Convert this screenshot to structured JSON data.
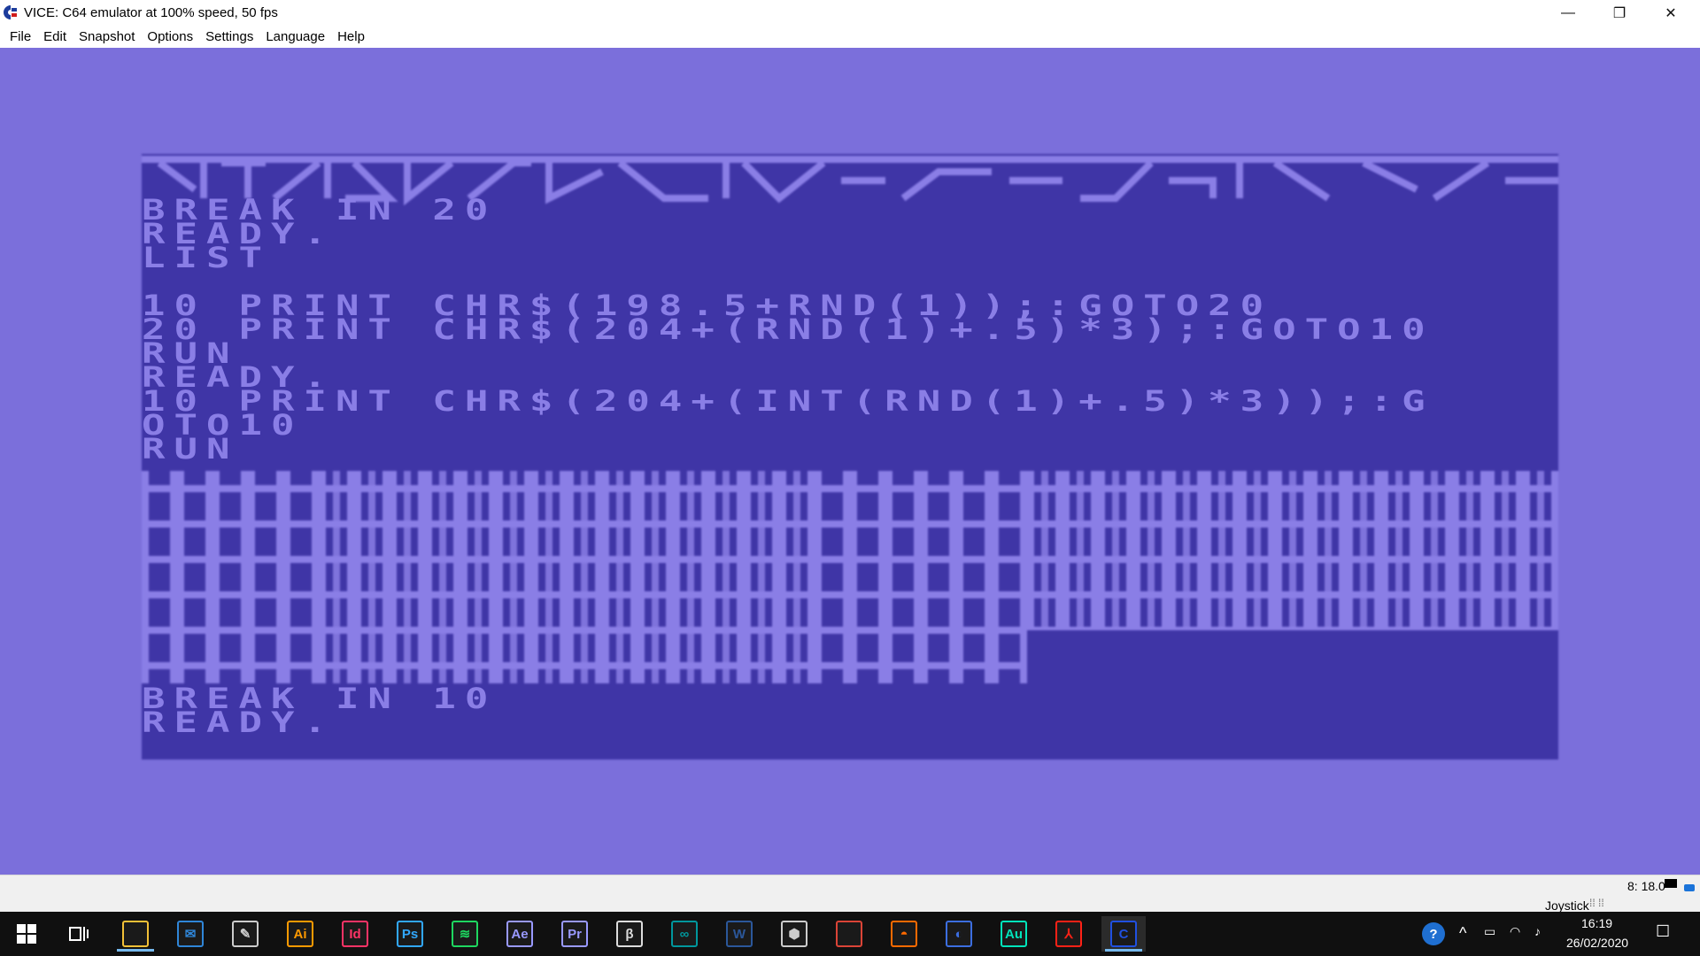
{
  "window": {
    "title": "VICE: C64 emulator at 100% speed, 50 fps",
    "minimize_glyph": "—",
    "restore_glyph": "❐",
    "close_glyph": "✕"
  },
  "menu": [
    "File",
    "Edit",
    "Snapshot",
    "Options",
    "Settings",
    "Language",
    "Help"
  ],
  "screen": {
    "lines": [
      "BREAK IN 20",
      "READY.",
      "LIST",
      "",
      "10 PRINT CHR$(198.5+RND(1));:GOTO20",
      "20 PRINT CHR$(204+(RND(1)+.5)*3);:GOTO10",
      "RUN",
      "READY.",
      "10 PRINT CHR$(204+(INT(RND(1)+.5)*3));:G",
      "OTO10",
      "RUN"
    ],
    "bottom_lines": [
      "BREAK IN 10",
      "READY."
    ],
    "colors": {
      "border": "#7b6fdb",
      "background": "#3f35a6",
      "text": "#8a7ee6"
    }
  },
  "status": {
    "drive": "8: 18.0",
    "joystick": "Joystick"
  },
  "taskbar": {
    "apps": [
      {
        "name": "file-explorer-icon",
        "glyph": "",
        "color": "#f2c037"
      },
      {
        "name": "mail-icon",
        "glyph": "✉",
        "color": "#2f86d8"
      },
      {
        "name": "inkscape-icon",
        "glyph": "✎",
        "color": "#cccccc"
      },
      {
        "name": "illustrator-icon",
        "glyph": "Ai",
        "color": "#ff9a00"
      },
      {
        "name": "indesign-icon",
        "glyph": "Id",
        "color": "#ff3366"
      },
      {
        "name": "photoshop-icon",
        "glyph": "Ps",
        "color": "#31a8ff"
      },
      {
        "name": "spotify-icon",
        "glyph": "≋",
        "color": "#1ed760"
      },
      {
        "name": "after-effects-icon",
        "glyph": "Ae",
        "color": "#9999ff"
      },
      {
        "name": "premiere-icon",
        "glyph": "Pr",
        "color": "#9999ff"
      },
      {
        "name": "app-b-icon",
        "glyph": "β",
        "color": "#dddddd"
      },
      {
        "name": "arduino-icon",
        "glyph": "∞",
        "color": "#00979d"
      },
      {
        "name": "word-icon",
        "glyph": "W",
        "color": "#2b579a"
      },
      {
        "name": "package-icon",
        "glyph": "⬢",
        "color": "#cccccc"
      },
      {
        "name": "chrome-icon",
        "glyph": "",
        "color": "#db4437"
      },
      {
        "name": "app-dome-icon",
        "glyph": "◓",
        "color": "#ff6a00"
      },
      {
        "name": "cinema4d-icon",
        "glyph": "◐",
        "color": "#3c6ee0"
      },
      {
        "name": "audition-icon",
        "glyph": "Au",
        "color": "#00e4bb"
      },
      {
        "name": "acrobat-icon",
        "glyph": "⅄",
        "color": "#ff2116"
      },
      {
        "name": "vice-icon",
        "glyph": "C",
        "color": "#2050e0"
      }
    ],
    "time": "16:19",
    "date": "26/02/2020"
  }
}
